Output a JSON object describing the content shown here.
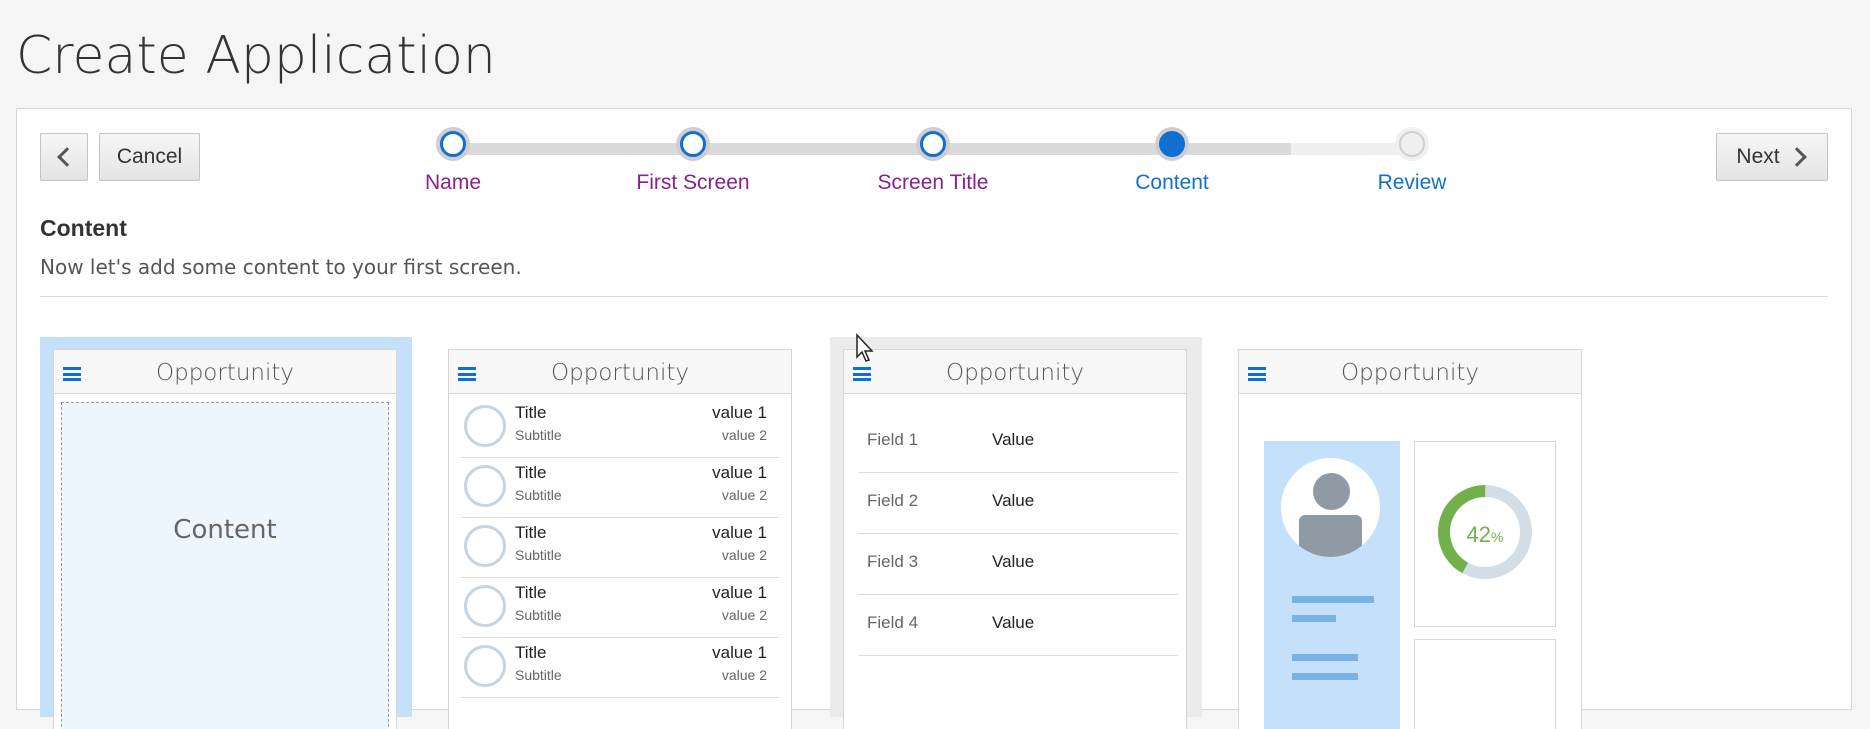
{
  "page": {
    "title": "Create Application"
  },
  "toolbar": {
    "back_icon": "chevron-left-icon",
    "cancel_label": "Cancel",
    "next_label": "Next",
    "next_icon": "chevron-right-icon"
  },
  "train": {
    "stops": [
      {
        "label": "Name",
        "state": "visited"
      },
      {
        "label": "First Screen",
        "state": "visited"
      },
      {
        "label": "Screen Title",
        "state": "visited"
      },
      {
        "label": "Content",
        "state": "current"
      },
      {
        "label": "Review",
        "state": "future"
      }
    ]
  },
  "section": {
    "title": "Content",
    "description": "Now let's add some content to your first screen."
  },
  "templates": [
    {
      "title": "Opportunity",
      "kind": "blank",
      "placeholder": "Content",
      "selected": true
    },
    {
      "title": "Opportunity",
      "kind": "list",
      "rows": [
        {
          "title": "Title",
          "subtitle": "Subtitle",
          "value1": "value 1",
          "value2": "value 2"
        },
        {
          "title": "Title",
          "subtitle": "Subtitle",
          "value1": "value 1",
          "value2": "value 2"
        },
        {
          "title": "Title",
          "subtitle": "Subtitle",
          "value1": "value 1",
          "value2": "value 2"
        },
        {
          "title": "Title",
          "subtitle": "Subtitle",
          "value1": "value 1",
          "value2": "value 2"
        },
        {
          "title": "Title",
          "subtitle": "Subtitle",
          "value1": "value 1",
          "value2": "value 2"
        }
      ]
    },
    {
      "title": "Opportunity",
      "kind": "form",
      "fields": [
        {
          "label": "Field 1",
          "value": "Value"
        },
        {
          "label": "Field 2",
          "value": "Value"
        },
        {
          "label": "Field 3",
          "value": "Value"
        },
        {
          "label": "Field 4",
          "value": "Value"
        }
      ]
    },
    {
      "title": "Opportunity",
      "kind": "dashboard",
      "donut_value": "42",
      "donut_unit": "%",
      "donut_fraction": 0.42,
      "donut_color": "#72b04b"
    }
  ],
  "colors": {
    "accent": "#1170cf",
    "visited": "#8a1f8e",
    "selected_card": "#c4e0fa"
  }
}
